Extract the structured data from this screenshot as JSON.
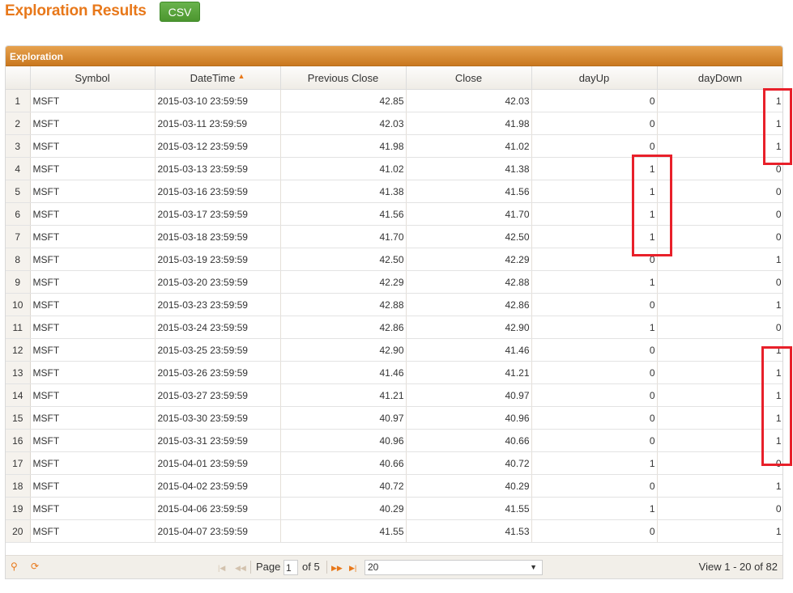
{
  "header": {
    "title": "Exploration Results",
    "csv_label": "CSV"
  },
  "grid": {
    "caption": "Exploration",
    "columns": [
      "Symbol",
      "DateTime",
      "Previous Close",
      "Close",
      "dayUp",
      "dayDown"
    ],
    "sort_column": "DateTime",
    "sort_icon": "sort-ascending-icon",
    "rows": [
      {
        "n": "1",
        "symbol": "MSFT",
        "datetime": "2015-03-10 23:59:59",
        "prev": "42.85",
        "close": "42.03",
        "up": "0",
        "down": "1"
      },
      {
        "n": "2",
        "symbol": "MSFT",
        "datetime": "2015-03-11 23:59:59",
        "prev": "42.03",
        "close": "41.98",
        "up": "0",
        "down": "1"
      },
      {
        "n": "3",
        "symbol": "MSFT",
        "datetime": "2015-03-12 23:59:59",
        "prev": "41.98",
        "close": "41.02",
        "up": "0",
        "down": "1"
      },
      {
        "n": "4",
        "symbol": "MSFT",
        "datetime": "2015-03-13 23:59:59",
        "prev": "41.02",
        "close": "41.38",
        "up": "1",
        "down": "0"
      },
      {
        "n": "5",
        "symbol": "MSFT",
        "datetime": "2015-03-16 23:59:59",
        "prev": "41.38",
        "close": "41.56",
        "up": "1",
        "down": "0"
      },
      {
        "n": "6",
        "symbol": "MSFT",
        "datetime": "2015-03-17 23:59:59",
        "prev": "41.56",
        "close": "41.70",
        "up": "1",
        "down": "0"
      },
      {
        "n": "7",
        "symbol": "MSFT",
        "datetime": "2015-03-18 23:59:59",
        "prev": "41.70",
        "close": "42.50",
        "up": "1",
        "down": "0"
      },
      {
        "n": "8",
        "symbol": "MSFT",
        "datetime": "2015-03-19 23:59:59",
        "prev": "42.50",
        "close": "42.29",
        "up": "0",
        "down": "1"
      },
      {
        "n": "9",
        "symbol": "MSFT",
        "datetime": "2015-03-20 23:59:59",
        "prev": "42.29",
        "close": "42.88",
        "up": "1",
        "down": "0"
      },
      {
        "n": "10",
        "symbol": "MSFT",
        "datetime": "2015-03-23 23:59:59",
        "prev": "42.88",
        "close": "42.86",
        "up": "0",
        "down": "1"
      },
      {
        "n": "11",
        "symbol": "MSFT",
        "datetime": "2015-03-24 23:59:59",
        "prev": "42.86",
        "close": "42.90",
        "up": "1",
        "down": "0"
      },
      {
        "n": "12",
        "symbol": "MSFT",
        "datetime": "2015-03-25 23:59:59",
        "prev": "42.90",
        "close": "41.46",
        "up": "0",
        "down": "1"
      },
      {
        "n": "13",
        "symbol": "MSFT",
        "datetime": "2015-03-26 23:59:59",
        "prev": "41.46",
        "close": "41.21",
        "up": "0",
        "down": "1"
      },
      {
        "n": "14",
        "symbol": "MSFT",
        "datetime": "2015-03-27 23:59:59",
        "prev": "41.21",
        "close": "40.97",
        "up": "0",
        "down": "1"
      },
      {
        "n": "15",
        "symbol": "MSFT",
        "datetime": "2015-03-30 23:59:59",
        "prev": "40.97",
        "close": "40.96",
        "up": "0",
        "down": "1"
      },
      {
        "n": "16",
        "symbol": "MSFT",
        "datetime": "2015-03-31 23:59:59",
        "prev": "40.96",
        "close": "40.66",
        "up": "0",
        "down": "1"
      },
      {
        "n": "17",
        "symbol": "MSFT",
        "datetime": "2015-04-01 23:59:59",
        "prev": "40.66",
        "close": "40.72",
        "up": "1",
        "down": "0"
      },
      {
        "n": "18",
        "symbol": "MSFT",
        "datetime": "2015-04-02 23:59:59",
        "prev": "40.72",
        "close": "40.29",
        "up": "0",
        "down": "1"
      },
      {
        "n": "19",
        "symbol": "MSFT",
        "datetime": "2015-04-06 23:59:59",
        "prev": "40.29",
        "close": "41.55",
        "up": "1",
        "down": "0"
      },
      {
        "n": "20",
        "symbol": "MSFT",
        "datetime": "2015-04-07 23:59:59",
        "prev": "41.55",
        "close": "41.53",
        "up": "0",
        "down": "1"
      }
    ]
  },
  "pager": {
    "search_icon": "search-icon",
    "refresh_icon": "refresh-icon",
    "page_label": "Page",
    "page_value": "1",
    "of_label": "of 5",
    "rows_per_page": "20",
    "view_text": "View 1 - 20 of 82"
  },
  "colors": {
    "accent": "#e8781a",
    "csv_button": "#5aa63c",
    "highlight": "#e8202a"
  }
}
